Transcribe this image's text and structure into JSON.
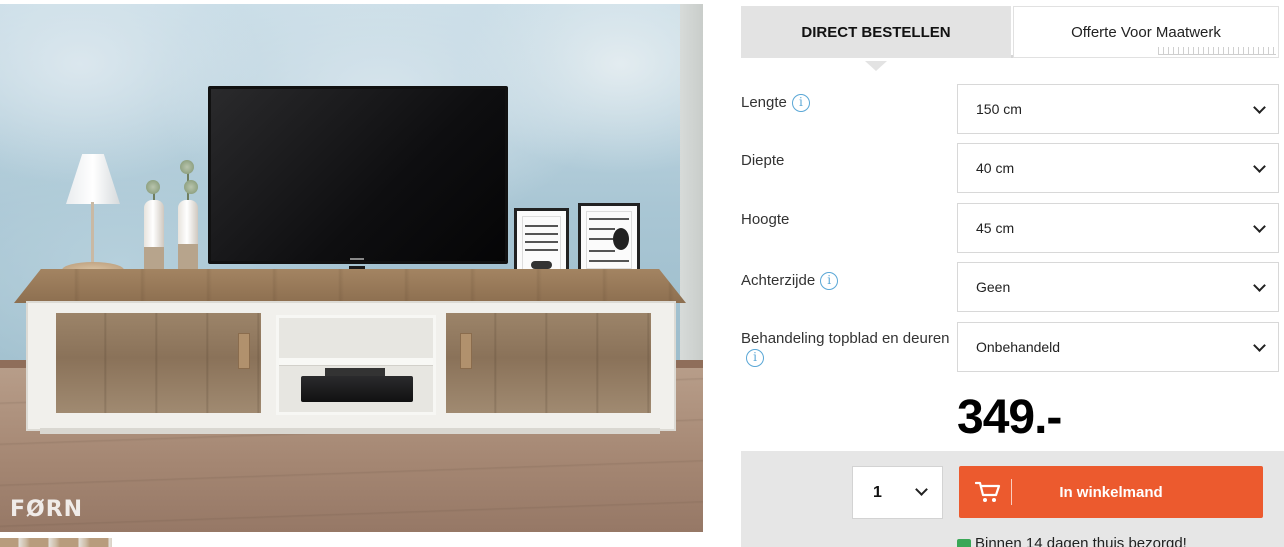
{
  "photo": {
    "watermark": "FØRN",
    "frame_left_text": "YOU MAKE ME HAPPY WHEN SKIES ARE GREY",
    "frame_right_text": "I LOVE YOU TO THE moon AND BACK"
  },
  "tabs": [
    {
      "label": "DIRECT BESTELLEN",
      "active": true
    },
    {
      "label": "Offerte Voor Maatwerk",
      "active": false
    }
  ],
  "options": [
    {
      "label": "Lengte",
      "value": "150 cm",
      "has_info": true
    },
    {
      "label": "Diepte",
      "value": "40 cm",
      "has_info": false
    },
    {
      "label": "Hoogte",
      "value": "45 cm",
      "has_info": false
    },
    {
      "label": "Achterzijde",
      "value": "Geen",
      "has_info": true
    },
    {
      "label": "Behandeling topblad en deuren",
      "value": "Onbehandeld",
      "has_info": true
    }
  ],
  "info_glyph": "i",
  "price": "349.-",
  "cart": {
    "quantity": "1",
    "button_label": "In winkelmand",
    "delivery_text": "Binnen 14 dagen thuis bezorgd!"
  },
  "colors": {
    "accent": "#ec5a2e",
    "info": "#5aa7d6",
    "tab_active_bg": "#e3e3e3",
    "cart_bar_bg": "#e6e6e6",
    "delivery_icon": "#3aa757"
  },
  "icons": {
    "option_info": "info-circle-icon",
    "select_arrow": "chevron-down-icon",
    "cart": "shopping-cart-icon",
    "delivery": "truck-icon"
  }
}
